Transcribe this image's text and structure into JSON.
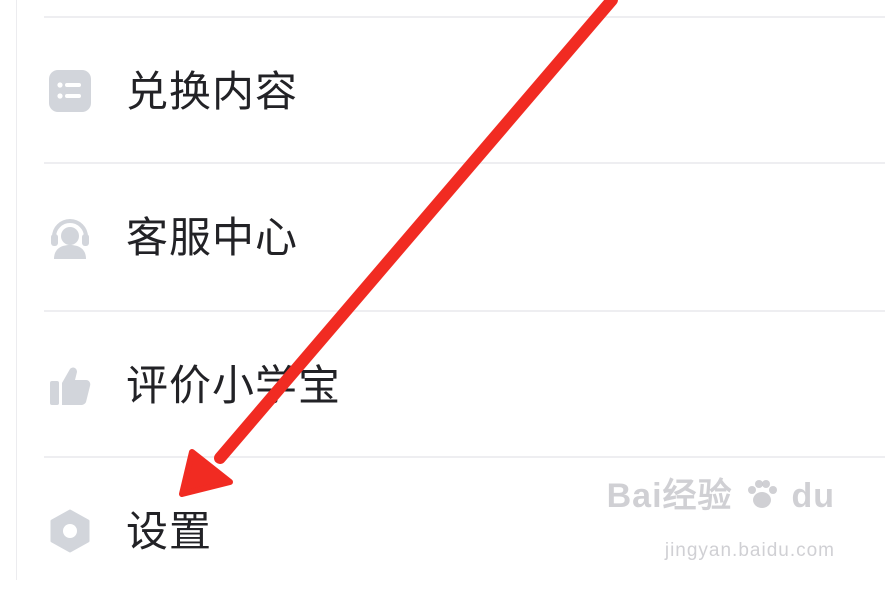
{
  "menu": {
    "items": [
      {
        "label": "兑换内容",
        "icon": "list-icon"
      },
      {
        "label": "客服中心",
        "icon": "headset-icon"
      },
      {
        "label": "评价小学宝",
        "icon": "thumbs-up-icon"
      },
      {
        "label": "设置",
        "icon": "hexagon-settings-icon"
      }
    ]
  },
  "annotation": {
    "arrow_color": "#f12b22"
  },
  "watermark": {
    "brand": "Bai经验",
    "brand_du": "du",
    "url": "jingyan.baidu.com"
  },
  "colors": {
    "icon_gray": "#d2d5db",
    "text": "#222226",
    "divider": "#eeeef1"
  }
}
